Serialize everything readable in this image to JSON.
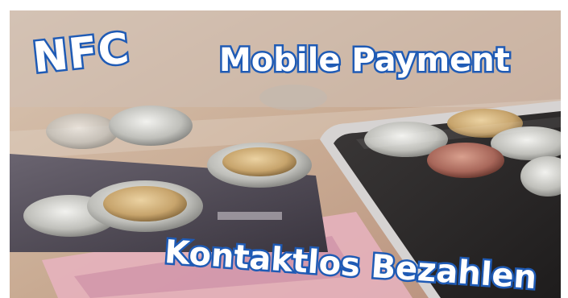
{
  "captions": {
    "nfc": "NFC",
    "mobile_payment": "Mobile Payment",
    "contactless": "Kontaktlos Bezahlen"
  },
  "colors": {
    "text_fill": "#ffffff",
    "text_outline": "#1f5bb5"
  }
}
